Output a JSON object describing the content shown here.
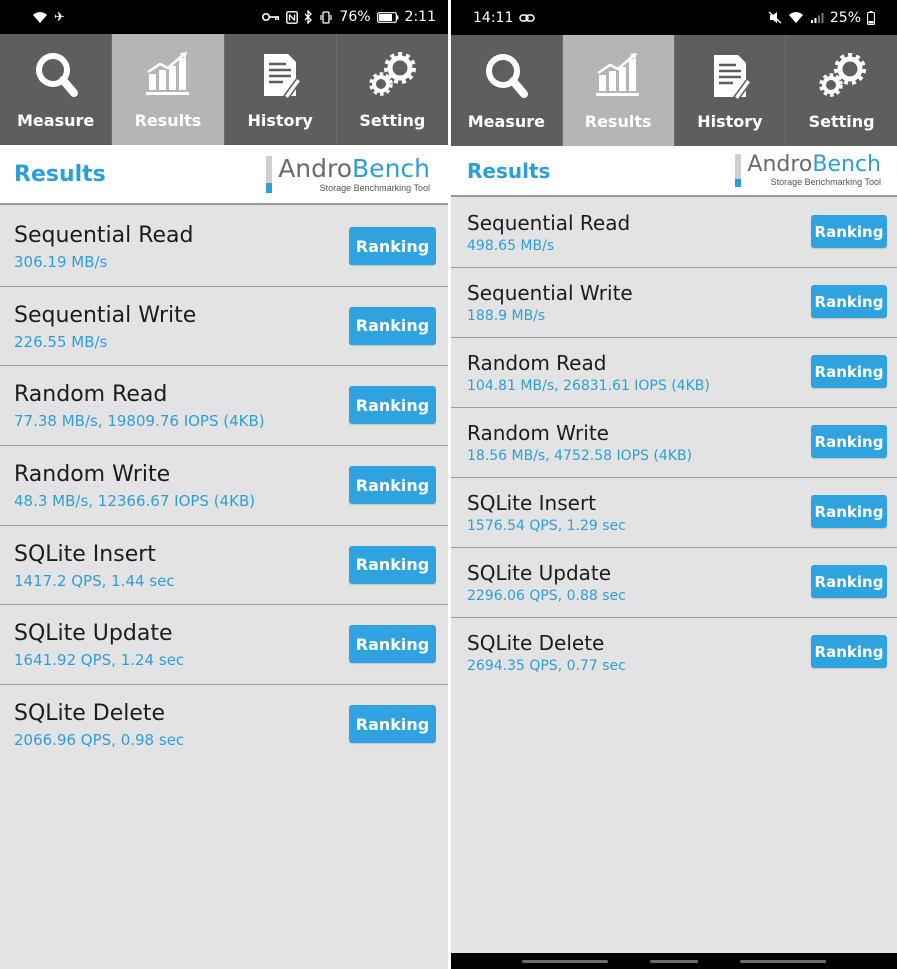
{
  "left": {
    "status": {
      "time": "2:11",
      "battery": "76%"
    },
    "nav": [
      {
        "label": "Measure",
        "icon": "magnifier-icon"
      },
      {
        "label": "Results",
        "icon": "bar-chart-icon"
      },
      {
        "label": "History",
        "icon": "document-icon"
      },
      {
        "label": "Setting",
        "icon": "gears-icon"
      }
    ],
    "header": {
      "title": "Results",
      "logo_andro": "Andro",
      "logo_bench": "Bench",
      "logo_sub": "Storage Benchmarking Tool"
    },
    "rows": [
      {
        "name": "Sequential Read",
        "value": "306.19 MB/s",
        "button": "Ranking"
      },
      {
        "name": "Sequential Write",
        "value": "226.55 MB/s",
        "button": "Ranking"
      },
      {
        "name": "Random Read",
        "value": "77.38 MB/s, 19809.76 IOPS (4KB)",
        "button": "Ranking"
      },
      {
        "name": "Random Write",
        "value": "48.3 MB/s, 12366.67 IOPS (4KB)",
        "button": "Ranking"
      },
      {
        "name": "SQLite Insert",
        "value": "1417.2 QPS, 1.44 sec",
        "button": "Ranking"
      },
      {
        "name": "SQLite Update",
        "value": "1641.92 QPS, 1.24 sec",
        "button": "Ranking"
      },
      {
        "name": "SQLite Delete",
        "value": "2066.96 QPS, 0.98 sec",
        "button": "Ranking"
      }
    ]
  },
  "right": {
    "status": {
      "time": "14:11",
      "battery": "25%"
    },
    "nav": [
      {
        "label": "Measure",
        "icon": "magnifier-icon"
      },
      {
        "label": "Results",
        "icon": "bar-chart-icon"
      },
      {
        "label": "History",
        "icon": "document-icon"
      },
      {
        "label": "Setting",
        "icon": "gears-icon"
      }
    ],
    "header": {
      "title": "Results",
      "logo_andro": "Andro",
      "logo_bench": "Bench",
      "logo_sub": "Storage Benchmarking Tool"
    },
    "rows": [
      {
        "name": "Sequential Read",
        "value": "498.65 MB/s",
        "button": "Ranking"
      },
      {
        "name": "Sequential Write",
        "value": "188.9 MB/s",
        "button": "Ranking"
      },
      {
        "name": "Random Read",
        "value": "104.81 MB/s, 26831.61 IOPS (4KB)",
        "button": "Ranking"
      },
      {
        "name": "Random Write",
        "value": "18.56 MB/s, 4752.58 IOPS (4KB)",
        "button": "Ranking"
      },
      {
        "name": "SQLite Insert",
        "value": "1576.54 QPS, 1.29 sec",
        "button": "Ranking"
      },
      {
        "name": "SQLite Update",
        "value": "2296.06 QPS, 0.88 sec",
        "button": "Ranking"
      },
      {
        "name": "SQLite Delete",
        "value": "2694.35 QPS, 0.77 sec",
        "button": "Ranking"
      }
    ]
  },
  "colors": {
    "accent": "#2d9fd8",
    "button": "#2ea3e0",
    "nav_bg": "#5e5e5e",
    "nav_active": "#b5b5b5",
    "list_bg": "#e3e3e3"
  }
}
